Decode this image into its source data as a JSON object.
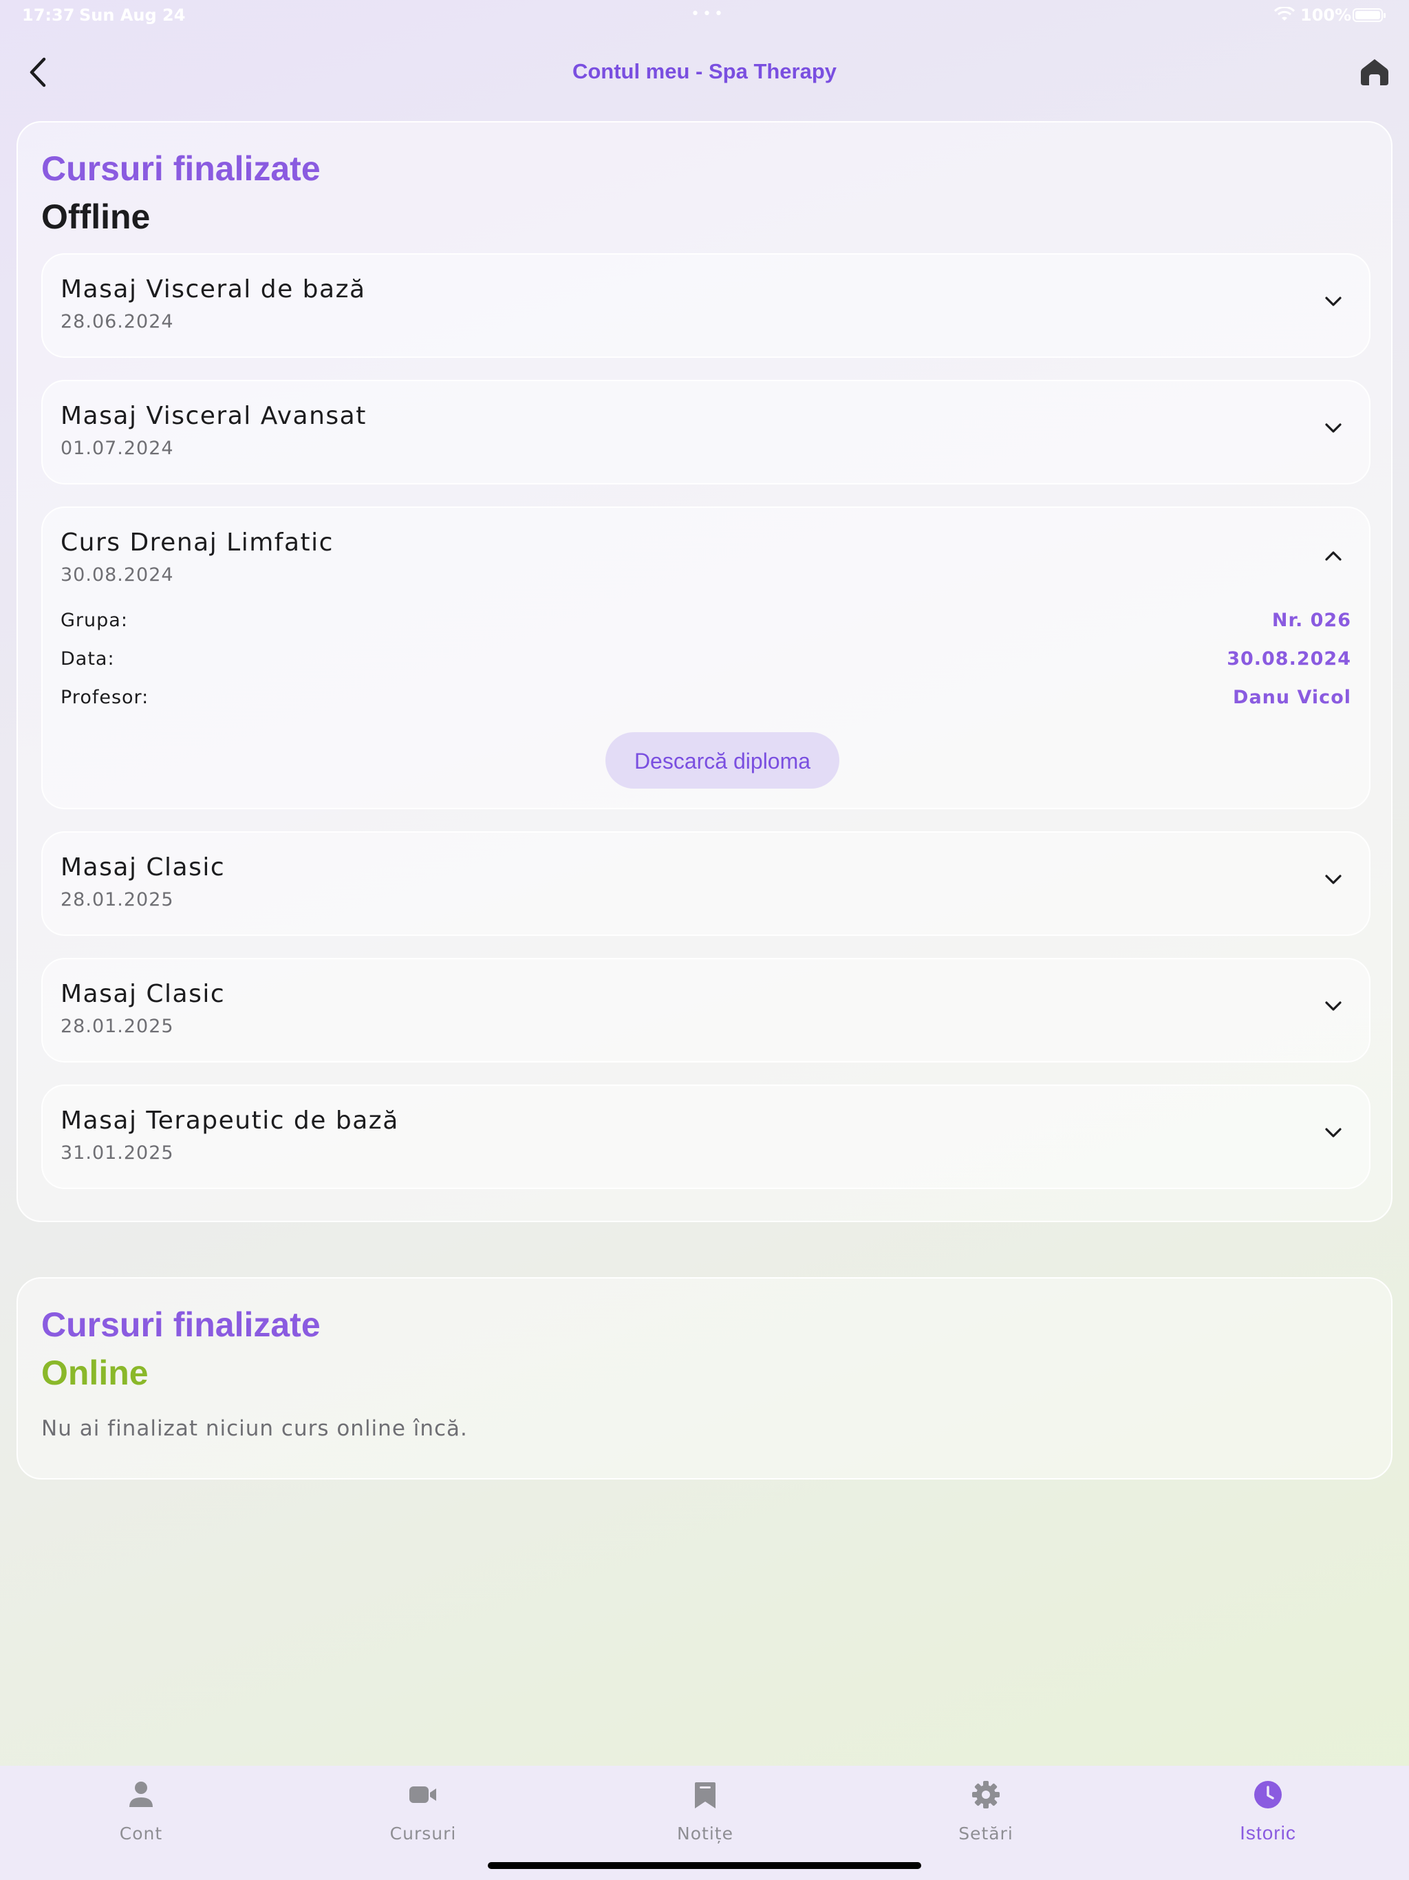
{
  "status_bar": {
    "time": "17:37",
    "date": "Sun Aug 24",
    "battery": "100%"
  },
  "nav": {
    "title": "Contul meu - Spa Therapy",
    "back_icon": "chevron-left-icon",
    "home_icon": "home-icon"
  },
  "offline": {
    "title": "Cursuri finalizate",
    "subtitle": "Offline",
    "courses": [
      {
        "name": "Masaj Visceral de bază",
        "date": "28.06.2024",
        "expanded": false
      },
      {
        "name": "Masaj Visceral Avansat",
        "date": "01.07.2024",
        "expanded": false
      },
      {
        "name": "Curs Drenaj Limfatic",
        "date": "30.08.2024",
        "expanded": true,
        "details": {
          "group_label": "Grupa:",
          "group_value": "Nr. 026",
          "date_label": "Data:",
          "date_value": "30.08.2024",
          "teacher_label": "Profesor:",
          "teacher_value": "Danu Vicol",
          "download_label": "Descarcă diploma"
        }
      },
      {
        "name": "Masaj Clasic",
        "date": "28.01.2025",
        "expanded": false
      },
      {
        "name": "Masaj Clasic",
        "date": "28.01.2025",
        "expanded": false
      },
      {
        "name": "Masaj Terapeutic de bază",
        "date": "31.01.2025",
        "expanded": false
      }
    ]
  },
  "online": {
    "title": "Cursuri finalizate",
    "subtitle": "Online",
    "empty_text": "Nu ai finalizat niciun curs online încă."
  },
  "tabs": [
    {
      "label": "Cont",
      "icon": "person-icon",
      "active": false
    },
    {
      "label": "Cursuri",
      "icon": "video-camera-icon",
      "active": false
    },
    {
      "label": "Notițe",
      "icon": "bookmark-icon",
      "active": false
    },
    {
      "label": "Setări",
      "icon": "gear-icon",
      "active": false
    },
    {
      "label": "Istoric",
      "icon": "clock-icon",
      "active": true
    }
  ],
  "colors": {
    "accent": "#8a5be0",
    "online_green": "#8ab82a",
    "text_dark": "#1c1c1e",
    "text_muted": "#6f6f74",
    "tab_inactive": "#8e8e93"
  }
}
